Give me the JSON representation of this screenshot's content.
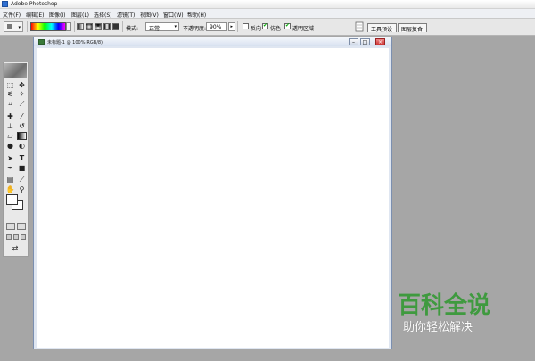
{
  "window": {
    "title": "Adobe Photoshop"
  },
  "menu": [
    "文件(F)",
    "编辑(E)",
    "图像(I)",
    "图层(L)",
    "选择(S)",
    "滤镜(T)",
    "视图(V)",
    "窗口(W)",
    "帮助(H)"
  ],
  "options": {
    "mode_label": "模式:",
    "mode_value": "正常",
    "opacity_label": "不透明度:",
    "opacity_value": "90%",
    "reverse_label": "反向",
    "dither_label": "仿色",
    "transparency_label": "透明区域",
    "checks": {
      "reverse": false,
      "dither": true,
      "transparency": true
    }
  },
  "panel_tabs": [
    "工具预设",
    "图层复合"
  ],
  "document": {
    "title": "未标题-1 @ 100%(RGB/8)"
  },
  "watermark": {
    "main": "百科全说",
    "sub": "助你轻松解决"
  },
  "colors": {
    "canvas": "#ffffff",
    "workspace": "#a6a6a6",
    "watermark_green": "#3f9a3f"
  },
  "icons": [
    "app-icon",
    "brush-icon",
    "gradient-icon",
    "marquee-icon",
    "move-icon",
    "lasso-icon",
    "magic-wand-icon",
    "crop-icon",
    "slice-icon",
    "healing-icon",
    "brush-tool-icon",
    "stamp-icon",
    "history-brush-icon",
    "eraser-icon",
    "gradient-tool-icon",
    "blur-icon",
    "dodge-icon",
    "path-select-icon",
    "type-icon",
    "pen-icon",
    "shape-icon",
    "notes-icon",
    "eyedropper-icon",
    "hand-icon",
    "zoom-icon"
  ]
}
